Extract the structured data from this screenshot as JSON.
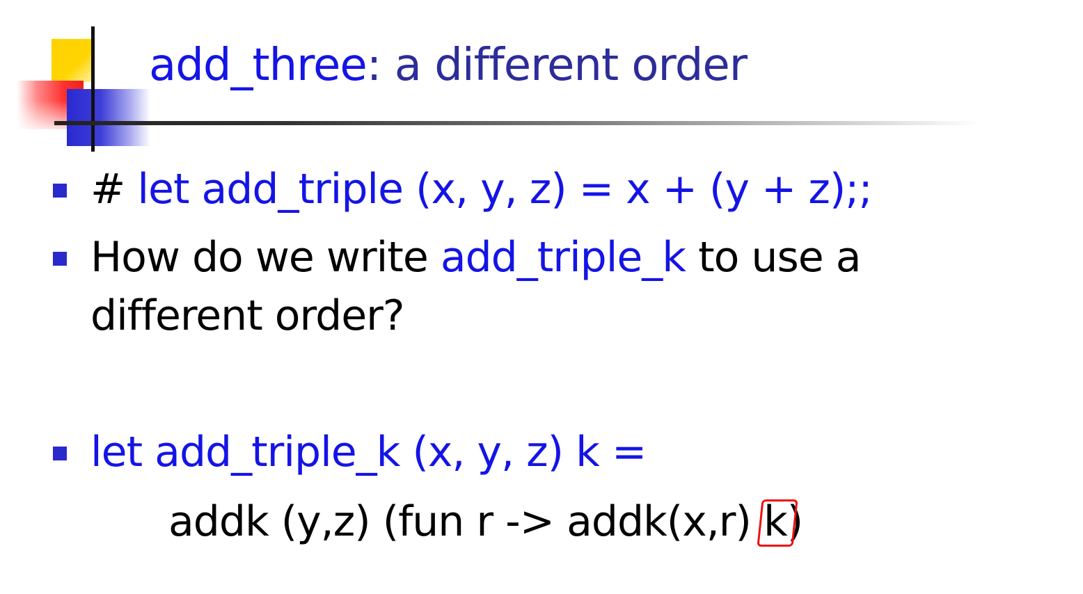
{
  "title": {
    "main": "add_three",
    "rest": ": a different order"
  },
  "bullets": {
    "b1": {
      "prompt": "# ",
      "code": "let add_triple (x, y, z) = x + (y + z);;"
    },
    "b2": {
      "text_before": "How do we write ",
      "code": "add_triple_k",
      "text_after": " to use a",
      "line2": "different order?"
    },
    "b3": {
      "code": "let add_triple_k (x, y, z) k =",
      "line2_before": "addk (y,z) (fun r -> addk(x,r) ",
      "line2_boxed": "k",
      "line2_after": ")"
    }
  },
  "colors": {
    "code_blue": "#1414e6",
    "title_navy": "#2c2c9a",
    "bullet_square": "#2a2acc",
    "annotation_red": "#ee1111"
  }
}
